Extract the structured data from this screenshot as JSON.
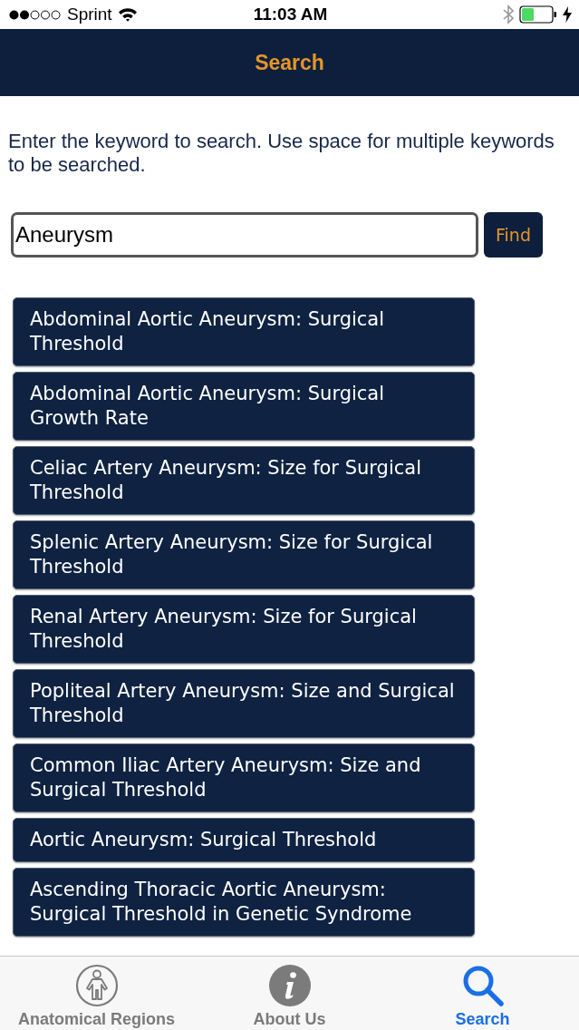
{
  "status_bar": {
    "carrier": "Sprint",
    "time": "11:03 AM"
  },
  "nav_bar": {
    "title": "Search"
  },
  "instructions": "Enter the keyword to search. Use space for multiple keywords to be searched.",
  "search": {
    "value": "Aneurysm",
    "button": "Find"
  },
  "results": [
    "Abdominal Aortic Aneurysm: Surgical Threshold",
    "Abdominal Aortic Aneurysm: Surgical Growth Rate",
    "Celiac Artery Aneurysm: Size for Surgical Threshold",
    "Splenic Artery Aneurysm: Size for Surgical Threshold",
    "Renal Artery Aneurysm: Size for Surgical Threshold",
    "Popliteal Artery Aneurysm: Size and Surgical Threshold",
    "Common Iliac Artery Aneurysm: Size and Surgical Threshold",
    "Aortic Aneurysm: Surgical Threshold",
    "Ascending Thoracic Aortic Aneurysm: Surgical Threshold in Genetic Syndrome"
  ],
  "tab_bar": [
    {
      "label": "Anatomical Regions",
      "selected": false
    },
    {
      "label": "About Us",
      "selected": false
    },
    {
      "label": "Search",
      "selected": true
    }
  ]
}
